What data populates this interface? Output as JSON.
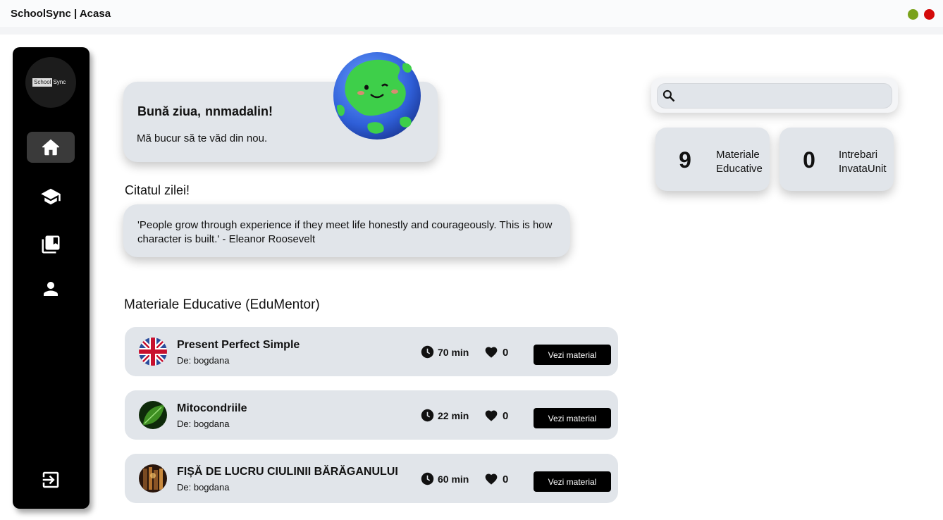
{
  "window": {
    "title": "SchoolSync | Acasa",
    "minimize_color": "#7aa21a",
    "close_color": "#d40a0a"
  },
  "sidebar": {
    "logo": {
      "part1": "School",
      "part2": "Sync"
    },
    "items": [
      {
        "name": "home",
        "icon": "home-icon",
        "active": true
      },
      {
        "name": "education",
        "icon": "graduation-cap-icon",
        "active": false
      },
      {
        "name": "library",
        "icon": "bookmark-books-icon",
        "active": false
      },
      {
        "name": "profile",
        "icon": "user-icon",
        "active": false
      }
    ],
    "logout_icon": "logout-icon"
  },
  "greeting": {
    "hello": "Bună ziua,",
    "username": "nnmadalin!",
    "subtitle": "Mă bucur să te văd din nou."
  },
  "quote": {
    "heading": "Citatul zilei!",
    "text": "'People grow through experience if they meet life honestly and courageously. This is how character is built.' - Eleanor Roosevelt"
  },
  "materials": {
    "heading": "Materiale Educative (EduMentor)",
    "items": [
      {
        "title": "Present Perfect Simple",
        "author": "De: bogdana",
        "time": "70 min",
        "likes": "0",
        "button": "Vezi material",
        "thumb": "uk-flag"
      },
      {
        "title": "Mitocondriile",
        "author": "De: bogdana",
        "time": "22 min",
        "likes": "0",
        "button": "Vezi material",
        "thumb": "green-leaf"
      },
      {
        "title": "FIȘĂ DE LUCRU CIULINII BĂRĂGANULUI",
        "author": "De: bogdana",
        "time": "60 min",
        "likes": "0",
        "button": "Vezi material",
        "thumb": "library"
      }
    ]
  },
  "search": {
    "placeholder": ""
  },
  "stats": [
    {
      "value": "9",
      "label_line1": "Materiale",
      "label_line2": "Educative"
    },
    {
      "value": "0",
      "label_line1": "Intrebari",
      "label_line2": "InvataUnit"
    }
  ]
}
